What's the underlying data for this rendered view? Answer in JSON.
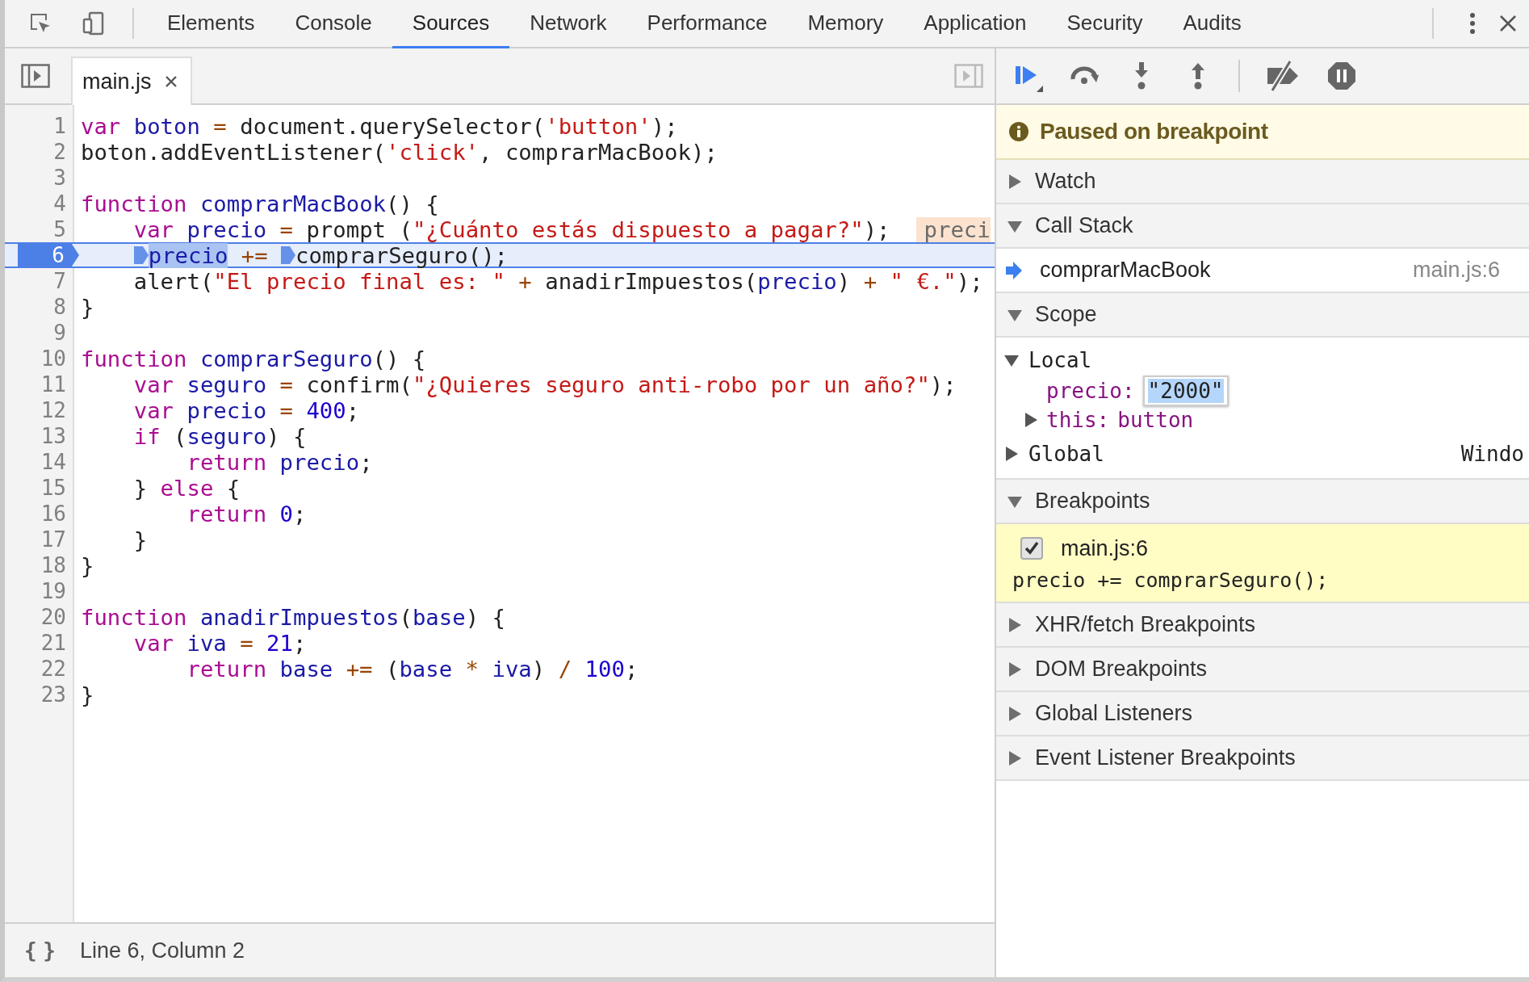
{
  "toolbar": {
    "tabs": [
      {
        "label": "Elements",
        "selected": false
      },
      {
        "label": "Console",
        "selected": false
      },
      {
        "label": "Sources",
        "selected": true
      },
      {
        "label": "Network",
        "selected": false
      },
      {
        "label": "Performance",
        "selected": false
      },
      {
        "label": "Memory",
        "selected": false
      },
      {
        "label": "Application",
        "selected": false
      },
      {
        "label": "Security",
        "selected": false
      },
      {
        "label": "Audits",
        "selected": false
      }
    ]
  },
  "editor": {
    "file_tab": {
      "label": "main.js",
      "selected": true
    },
    "lines": [
      {
        "number": "1",
        "breakpoint": false,
        "paused": false,
        "tokens": [
          {
            "text": "var",
            "kind": "keyword"
          },
          {
            "text": " boton",
            "kind": "variable"
          },
          {
            "text": " =",
            "kind": "operator"
          },
          {
            "text": " document.querySelector(",
            "kind": "plain"
          },
          {
            "text": "'button'",
            "kind": "string"
          },
          {
            "text": ");",
            "kind": "plain"
          }
        ]
      },
      {
        "number": "2",
        "breakpoint": false,
        "paused": false,
        "tokens": [
          {
            "text": "boton.addEventListener(",
            "kind": "plain"
          },
          {
            "text": "'click'",
            "kind": "string"
          },
          {
            "text": ", comprarMacBook);",
            "kind": "plain"
          }
        ]
      },
      {
        "number": "3",
        "breakpoint": false,
        "paused": false
      },
      {
        "number": "4",
        "breakpoint": false,
        "paused": false,
        "tokens": [
          {
            "text": "function",
            "kind": "keyword"
          },
          {
            "text": " comprarMacBook",
            "kind": "variable"
          },
          {
            "text": "() {",
            "kind": "plain"
          }
        ]
      },
      {
        "number": "5",
        "breakpoint": false,
        "paused": false,
        "tokens": [
          {
            "text": "    var",
            "kind": "keyword"
          },
          {
            "text": " precio",
            "kind": "variable"
          },
          {
            "text": " =",
            "kind": "operator"
          },
          {
            "text": " prompt (",
            "kind": "plain"
          },
          {
            "text": "\"¿Cuánto estás dispuesto a pagar?\"",
            "kind": "string"
          },
          {
            "text": ");",
            "kind": "plain"
          },
          {
            "text": "preci",
            "kind": "inline-value"
          }
        ]
      },
      {
        "number": "6",
        "breakpoint": true,
        "paused": true,
        "tokens": [
          {
            "kind": "marker"
          },
          {
            "text": "    precio",
            "kind": "selected-variable"
          },
          {
            "text": " +=",
            "kind": "operator"
          },
          {
            "kind": "marker"
          },
          {
            "text": " comprarSeguro();",
            "kind": "plain"
          }
        ]
      },
      {
        "number": "7",
        "breakpoint": false,
        "paused": false,
        "tokens": [
          {
            "text": "    alert(",
            "kind": "plain"
          },
          {
            "text": "\"El precio final es: \"",
            "kind": "string"
          },
          {
            "text": " +",
            "kind": "operator"
          },
          {
            "text": " anadirImpuestos(",
            "kind": "plain"
          },
          {
            "text": "precio",
            "kind": "variable"
          },
          {
            "text": ")",
            "kind": "plain"
          },
          {
            "text": " +",
            "kind": "operator"
          },
          {
            "text": " \" €.\"",
            "kind": "string"
          },
          {
            "text": ");",
            "kind": "plain"
          }
        ]
      },
      {
        "number": "8",
        "breakpoint": false,
        "paused": false,
        "tokens": [
          {
            "text": "}",
            "kind": "plain"
          }
        ]
      },
      {
        "number": "9",
        "breakpoint": false,
        "paused": false
      },
      {
        "number": "10",
        "breakpoint": false,
        "paused": false,
        "tokens": [
          {
            "text": "function",
            "kind": "keyword"
          },
          {
            "text": " comprarSeguro",
            "kind": "variable"
          },
          {
            "text": "() {",
            "kind": "plain"
          }
        ]
      },
      {
        "number": "11",
        "breakpoint": false,
        "paused": false,
        "tokens": [
          {
            "text": "    var",
            "kind": "keyword"
          },
          {
            "text": " seguro",
            "kind": "variable"
          },
          {
            "text": " =",
            "kind": "operator"
          },
          {
            "text": " confirm(",
            "kind": "plain"
          },
          {
            "text": "\"¿Quieres seguro anti-robo por un año?\"",
            "kind": "string"
          },
          {
            "text": ");",
            "kind": "plain"
          }
        ]
      },
      {
        "number": "12",
        "breakpoint": false,
        "paused": false,
        "tokens": [
          {
            "text": "    var",
            "kind": "keyword"
          },
          {
            "text": " precio",
            "kind": "variable"
          },
          {
            "text": " =",
            "kind": "operator"
          },
          {
            "text": " 400",
            "kind": "number"
          },
          {
            "text": ";",
            "kind": "plain"
          }
        ]
      },
      {
        "number": "13",
        "breakpoint": false,
        "paused": false,
        "tokens": [
          {
            "text": "    if",
            "kind": "keyword"
          },
          {
            "text": " (",
            "kind": "plain"
          },
          {
            "text": "seguro",
            "kind": "variable"
          },
          {
            "text": ") {",
            "kind": "plain"
          }
        ]
      },
      {
        "number": "14",
        "breakpoint": false,
        "paused": false,
        "tokens": [
          {
            "text": "        return",
            "kind": "keyword"
          },
          {
            "text": " precio",
            "kind": "variable"
          },
          {
            "text": ";",
            "kind": "plain"
          }
        ]
      },
      {
        "number": "15",
        "breakpoint": false,
        "paused": false,
        "tokens": [
          {
            "text": "    } ",
            "kind": "plain"
          },
          {
            "text": "else",
            "kind": "keyword"
          },
          {
            "text": " {",
            "kind": "plain"
          }
        ]
      },
      {
        "number": "16",
        "breakpoint": false,
        "paused": false,
        "tokens": [
          {
            "text": "        return",
            "kind": "keyword"
          },
          {
            "text": " 0",
            "kind": "number"
          },
          {
            "text": ";",
            "kind": "plain"
          }
        ]
      },
      {
        "number": "17",
        "breakpoint": false,
        "paused": false,
        "tokens": [
          {
            "text": "    }",
            "kind": "plain"
          }
        ]
      },
      {
        "number": "18",
        "breakpoint": false,
        "paused": false,
        "tokens": [
          {
            "text": "}",
            "kind": "plain"
          }
        ]
      },
      {
        "number": "19",
        "breakpoint": false,
        "paused": false
      },
      {
        "number": "20",
        "breakpoint": false,
        "paused": false,
        "tokens": [
          {
            "text": "function",
            "kind": "keyword"
          },
          {
            "text": " anadirImpuestos",
            "kind": "variable"
          },
          {
            "text": "(",
            "kind": "plain"
          },
          {
            "text": "base",
            "kind": "variable"
          },
          {
            "text": ") {",
            "kind": "plain"
          }
        ]
      },
      {
        "number": "21",
        "breakpoint": false,
        "paused": false,
        "tokens": [
          {
            "text": "    var",
            "kind": "keyword"
          },
          {
            "text": " iva",
            "kind": "variable"
          },
          {
            "text": " =",
            "kind": "operator"
          },
          {
            "text": " 21",
            "kind": "number"
          },
          {
            "text": ";",
            "kind": "plain"
          }
        ]
      },
      {
        "number": "22",
        "breakpoint": false,
        "paused": false,
        "tokens": [
          {
            "text": "        return",
            "kind": "keyword"
          },
          {
            "text": " base",
            "kind": "variable"
          },
          {
            "text": " +=",
            "kind": "operator"
          },
          {
            "text": " (",
            "kind": "plain"
          },
          {
            "text": "base",
            "kind": "variable"
          },
          {
            "text": " *",
            "kind": "operator"
          },
          {
            "text": " iva",
            "kind": "variable"
          },
          {
            "text": ")",
            "kind": "plain"
          },
          {
            "text": " /",
            "kind": "operator"
          },
          {
            "text": " 100",
            "kind": "number"
          },
          {
            "text": ";",
            "kind": "plain"
          }
        ]
      },
      {
        "number": "23",
        "breakpoint": false,
        "paused": false,
        "tokens": [
          {
            "text": "}",
            "kind": "plain"
          }
        ]
      }
    ],
    "status_bar": {
      "format_button": "{ }",
      "position": "Line 6, Column 2"
    }
  },
  "debugger": {
    "banner": "Paused on breakpoint",
    "sections": [
      {
        "title": "Watch",
        "expanded": false
      },
      {
        "title": "Call Stack",
        "expanded": true,
        "kind": "callstack",
        "frames": [
          {
            "name": "comprarMacBook",
            "location": "main.js:6",
            "current": true
          }
        ]
      },
      {
        "title": "Scope",
        "expanded": true,
        "kind": "scope",
        "scopes": [
          {
            "name": "Local",
            "expanded": true,
            "variables": [
              {
                "name": "precio:",
                "value": "\"2000\"",
                "editing": true,
                "expandable": false
              },
              {
                "name": "this:",
                "value": "button",
                "editing": false,
                "expandable": true
              }
            ]
          },
          {
            "name": "Global",
            "expanded": false,
            "value": "Windo"
          }
        ]
      },
      {
        "title": "Breakpoints",
        "expanded": true,
        "kind": "breakpoints",
        "items": [
          {
            "location": "main.js:6",
            "checked": true,
            "code": "precio += comprarSeguro();"
          }
        ]
      },
      {
        "title": "XHR/fetch Breakpoints",
        "expanded": false
      },
      {
        "title": "DOM Breakpoints",
        "expanded": false
      },
      {
        "title": "Global Listeners",
        "expanded": false
      },
      {
        "title": "Event Listener Breakpoints",
        "expanded": false
      }
    ]
  }
}
